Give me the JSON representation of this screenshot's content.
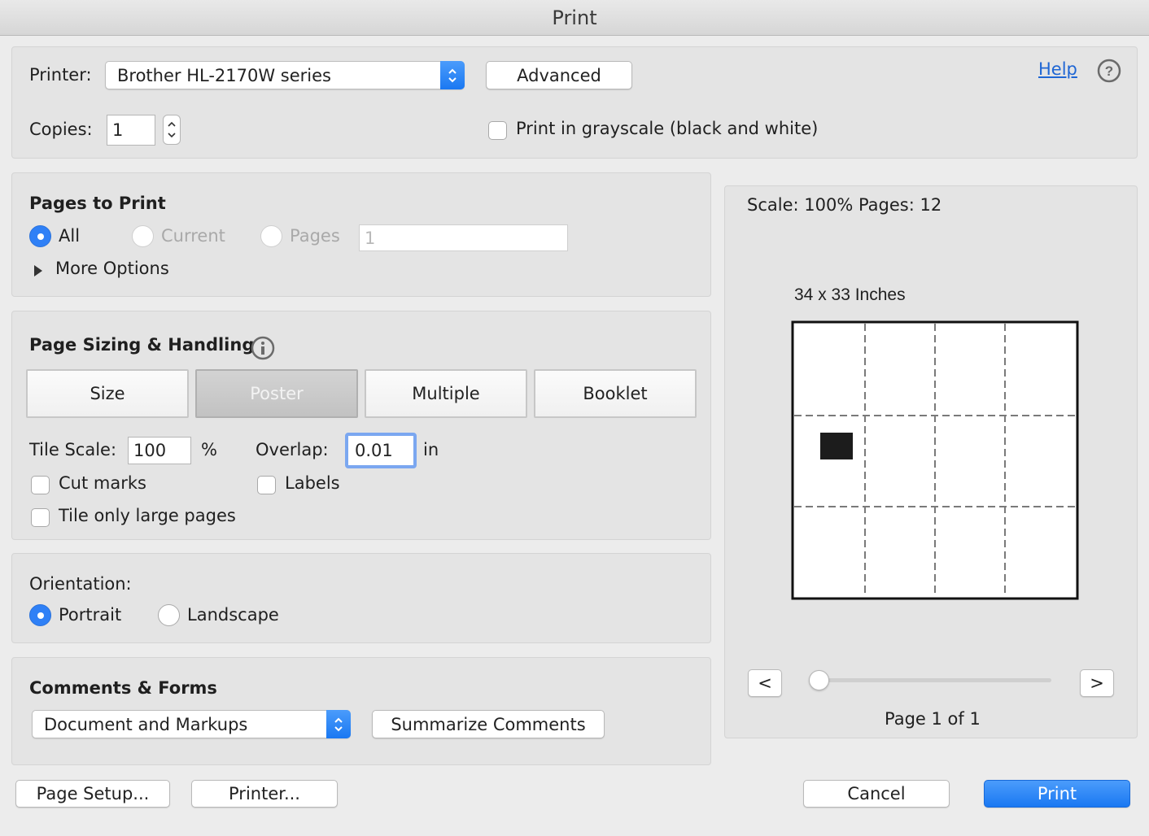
{
  "window": {
    "title": "Print"
  },
  "printer": {
    "label": "Printer:",
    "selected": "Brother HL-2170W series",
    "advanced_label": "Advanced",
    "help_label": "Help"
  },
  "copies": {
    "label": "Copies:",
    "value": "1"
  },
  "grayscale": {
    "label": "Print in grayscale (black and white)",
    "checked": false
  },
  "pages_to_print": {
    "heading": "Pages to Print",
    "options": [
      "All",
      "Current",
      "Pages"
    ],
    "selected": "All",
    "pages_value": "1",
    "more_options_label": "More Options"
  },
  "page_sizing": {
    "heading": "Page Sizing & Handling",
    "tabs": [
      "Size",
      "Poster",
      "Multiple",
      "Booklet"
    ],
    "active_tab": "Poster",
    "tile_scale_label": "Tile Scale:",
    "tile_scale_value": "100",
    "percent_unit": "%",
    "overlap_label": "Overlap:",
    "overlap_value": "0.01",
    "overlap_unit": "in",
    "cut_marks_label": "Cut marks",
    "labels_label": "Labels",
    "tile_only_large_label": "Tile only large pages"
  },
  "orientation": {
    "heading": "Orientation:",
    "options": [
      "Portrait",
      "Landscape"
    ],
    "selected": "Portrait"
  },
  "comments_forms": {
    "heading": "Comments & Forms",
    "selected": "Document and Markups",
    "summarize_label": "Summarize Comments"
  },
  "preview": {
    "scale_text": "Scale: 100% Pages: 12",
    "size_text": "34 x 33 Inches",
    "prev_label": "<",
    "next_label": ">",
    "page_text": "Page 1 of 1",
    "slider_position": 0
  },
  "footer": {
    "page_setup_label": "Page Setup...",
    "printer_label": "Printer...",
    "cancel_label": "Cancel",
    "print_label": "Print"
  },
  "colors": {
    "accent": "#1a78f2",
    "link": "#1f66d4"
  }
}
